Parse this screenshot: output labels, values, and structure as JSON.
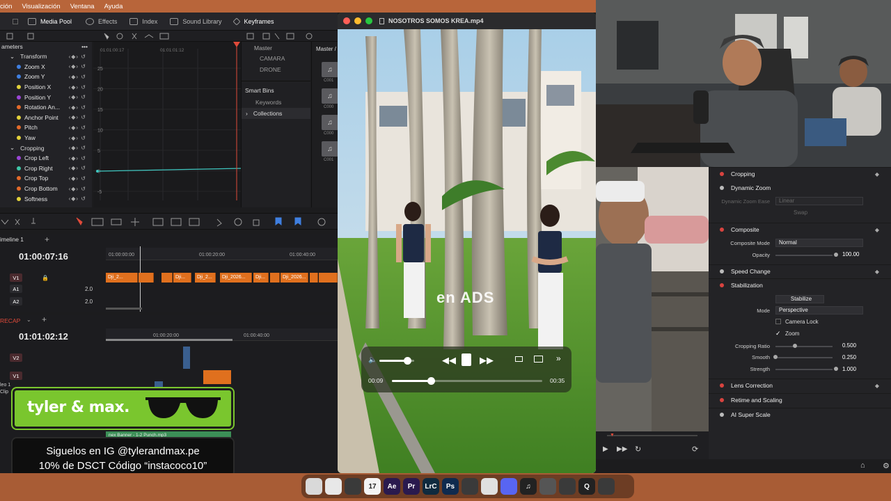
{
  "menu": [
    "ción",
    "Visualización",
    "Ventana",
    "Ayuda"
  ],
  "toolbar": {
    "items": [
      "Media Pool",
      "Effects",
      "Index",
      "Sound Library",
      "Keyframes"
    ]
  },
  "params": {
    "header": "ameters",
    "header_dots": "•••",
    "rows": [
      {
        "label": "Transform",
        "group": true,
        "color": ""
      },
      {
        "label": "Zoom X",
        "group": false,
        "color": "#3f7fe0"
      },
      {
        "label": "Zoom Y",
        "group": false,
        "color": "#3f7fe0"
      },
      {
        "label": "Position X",
        "group": false,
        "color": "#e3d23a"
      },
      {
        "label": "Position Y",
        "group": false,
        "color": "#9a46d6"
      },
      {
        "label": "Rotation An...",
        "group": false,
        "color": "#e36a2a"
      },
      {
        "label": "Anchor Point",
        "group": false,
        "color": "#e3d23a"
      },
      {
        "label": "Pitch",
        "group": false,
        "color": "#e36a2a"
      },
      {
        "label": "Yaw",
        "group": false,
        "color": "#e3d23a"
      },
      {
        "label": "Cropping",
        "group": true,
        "color": ""
      },
      {
        "label": "Crop Left",
        "group": false,
        "color": "#9a46d6"
      },
      {
        "label": "Crop Right",
        "group": false,
        "color": "#3fc7a8"
      },
      {
        "label": "Crop Top",
        "group": false,
        "color": "#e36a2a"
      },
      {
        "label": "Crop Bottom",
        "group": false,
        "color": "#e36a2a"
      },
      {
        "label": "Softness",
        "group": false,
        "color": "#e3d23a"
      }
    ]
  },
  "graph": {
    "timecodes": [
      "01:01:00:17",
      "01:01:01:12"
    ],
    "y_labels": [
      "25",
      "20",
      "15",
      "10",
      "5",
      "0",
      "-5"
    ]
  },
  "bins": {
    "master": "Master",
    "items": [
      "CAMARA",
      "DRONE"
    ],
    "smart_bins": "Smart Bins",
    "smart_items": [
      "Keywords",
      "Collections"
    ],
    "pool_header": "Master /",
    "thumb_labels": [
      "C001",
      "C000",
      "C000",
      "C001"
    ]
  },
  "timeline1": {
    "name": "imeline 1",
    "timecode": "01:00:07:16",
    "ruler": [
      "01:00:00:00",
      "01:00:20:00",
      "01:00:40:00"
    ],
    "tracks": [
      {
        "badge": "V1",
        "level": ""
      },
      {
        "badge": "A1",
        "level": "2.0"
      },
      {
        "badge": "A2",
        "level": "2.0"
      }
    ],
    "clips": [
      "Dji_2...",
      "Dji...",
      "Dji_2...",
      "Dji_2026...",
      "Dji...",
      "Dji_2026..."
    ]
  },
  "timeline2": {
    "name": "RECAP",
    "timecode": "01:01:02:12",
    "ruler": [
      "01:00:20:00",
      "01:00:40:00"
    ],
    "tracks": [
      {
        "badge": "V2"
      },
      {
        "badge": "V1"
      }
    ],
    "side_labels": [
      "leo 1",
      "Clip"
    ],
    "audio_clip": "nex Banner - 1-2 Punch.mp3"
  },
  "brand": {
    "name": "tyler & max."
  },
  "promo": {
    "line1": "Siguelos en IG @tylerandmax.pe",
    "line2": "10% de DSCT Código “instacoco10”"
  },
  "player": {
    "title": "NOSOTROS SOMOS KREA.mp4",
    "overlay_text": "en ADS",
    "current_time": "00:09",
    "total_time": "00:35",
    "progress": 0.26,
    "volume": 0.8
  },
  "inspector": {
    "sections": {
      "cropping": "Cropping",
      "dynamic_zoom": "Dynamic Zoom",
      "dynamic_zoom_ease": "Dynamic Zoom Ease",
      "dynamic_zoom_ease_value": "Linear",
      "swap": "Swap",
      "composite": "Composite",
      "composite_mode_label": "Composite Mode",
      "composite_mode_value": "Normal",
      "opacity_label": "Opacity",
      "opacity_value": "100.00",
      "speed_change": "Speed Change",
      "stabilization": "Stabilization",
      "stabilize_button": "Stabilize",
      "mode_label": "Mode",
      "mode_value": "Perspective",
      "camera_lock": "Camera Lock",
      "zoom": "Zoom",
      "cropping_ratio_label": "Cropping Ratio",
      "cropping_ratio_value": "0.500",
      "smooth_label": "Smooth",
      "smooth_value": "0.250",
      "strength_label": "Strength",
      "strength_value": "1.000",
      "lens_correction": "Lens Correction",
      "retime_scaling": "Retime and Scaling",
      "ai_super_scale": "AI Super Scale"
    }
  },
  "dock": {
    "items": [
      {
        "label": "",
        "color": "#d9d9d9"
      },
      {
        "label": "",
        "color": "#e8e8e8"
      },
      {
        "label": "",
        "color": "#3a3a3a"
      },
      {
        "label": "17",
        "color": "#f4f4f4"
      },
      {
        "label": "Ae",
        "color": "#2a1a4e"
      },
      {
        "label": "Pr",
        "color": "#2a1a4e"
      },
      {
        "label": "LrC",
        "color": "#0f2a3e"
      },
      {
        "label": "Ps",
        "color": "#0f2a4e"
      },
      {
        "label": "",
        "color": "#3a3a3a"
      },
      {
        "label": "",
        "color": "#e0e0e0"
      },
      {
        "label": "",
        "color": "#5865f2"
      },
      {
        "label": "♫",
        "color": "#222"
      },
      {
        "label": "",
        "color": "#555"
      },
      {
        "label": "",
        "color": "#3a3a3a"
      },
      {
        "label": "Q",
        "color": "#222"
      },
      {
        "label": "",
        "color": "#3a3a3a"
      }
    ]
  }
}
